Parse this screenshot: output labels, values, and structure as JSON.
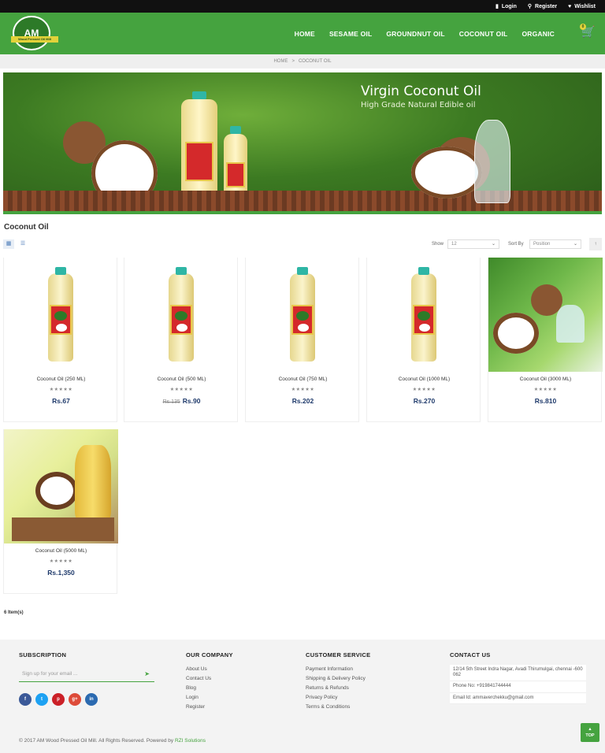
{
  "topbar": {
    "links": [
      {
        "icon": "lock-icon",
        "label": "Login"
      },
      {
        "icon": "key-icon",
        "label": "Register"
      },
      {
        "icon": "heart-icon",
        "label": "Wishlist"
      }
    ]
  },
  "header": {
    "logo_text": "AM",
    "logo_ribbon": "Wood Pressed Oil Mill",
    "nav": [
      "HOME",
      "SESAME OIL",
      "GROUNDNUT OIL",
      "COCONUT OIL",
      "ORGANIC"
    ],
    "cart_count": "0"
  },
  "breadcrumb": {
    "home": "HOME",
    "separator": ">",
    "current": "COCONUT OIL"
  },
  "banner": {
    "title": "Virgin Coconut Oil",
    "subtitle": "High Grade Natural Edible oil"
  },
  "page_title": "Coconut Oil",
  "toolbar": {
    "show_label": "Show",
    "show_value": "12",
    "sort_label": "Sort By",
    "sort_value": "Position",
    "sort_dir": "↑"
  },
  "products": [
    {
      "name": "Coconut Oil (250 ML)",
      "stars": "★★★★★",
      "old_price": "",
      "price": "Rs.67"
    },
    {
      "name": "Coconut Oil (500 ML)",
      "stars": "★★★★★",
      "old_price": "Rs.135",
      "price": "Rs.90"
    },
    {
      "name": "Coconut Oil (750 ML)",
      "stars": "★★★★★",
      "old_price": "",
      "price": "Rs.202"
    },
    {
      "name": "Coconut Oil (1000 ML)",
      "stars": "★★★★★",
      "old_price": "",
      "price": "Rs.270"
    },
    {
      "name": "Coconut Oil (3000 ML)",
      "stars": "★★★★★",
      "old_price": "",
      "price": "Rs.810"
    },
    {
      "name": "Coconut Oil (5000 ML)",
      "stars": "★★★★★",
      "old_price": "",
      "price": "Rs.1,350"
    }
  ],
  "item_count": "6 Item(s)",
  "footer": {
    "subscription": {
      "heading": "SUBSCRIPTION",
      "placeholder": "Sign up for your email ..."
    },
    "social": [
      {
        "name": "facebook-icon",
        "glyph": "f",
        "color": "#3b5998"
      },
      {
        "name": "twitter-icon",
        "glyph": "t",
        "color": "#1da1f2"
      },
      {
        "name": "pinterest-icon",
        "glyph": "p",
        "color": "#cb2027"
      },
      {
        "name": "google-plus-icon",
        "glyph": "g+",
        "color": "#dd4b39"
      },
      {
        "name": "linkedin-icon",
        "glyph": "in",
        "color": "#2b6ab0"
      }
    ],
    "company": {
      "heading": "OUR COMPANY",
      "links": [
        "About Us",
        "Contact Us",
        "Blog",
        "Login",
        "Register"
      ]
    },
    "service": {
      "heading": "CUSTOMER SERVICE",
      "links": [
        "Payment Information",
        "Shipping & Delivery Policy",
        "Returns & Refunds",
        "Privacy Policy",
        "Terms & Conditions"
      ]
    },
    "contact": {
      "heading": "CONTACT US",
      "address": "12/14 5th Street Indra Nagar, Avadi Thirumulgai, chennai -600 062",
      "phone": "Phone No: +919841744444",
      "email": "Email Id: ammaverchekku@gmail.com"
    },
    "copyright": "© 2017 AM Wood Pressed Oil Mill. All Rights Reserved. Powered by",
    "powered_by": "RZI Solutions"
  },
  "top_button": "TOP",
  "colors": {
    "brand_green": "#45a33f",
    "price_blue": "#1f3a6b",
    "topbar": "#111111"
  }
}
